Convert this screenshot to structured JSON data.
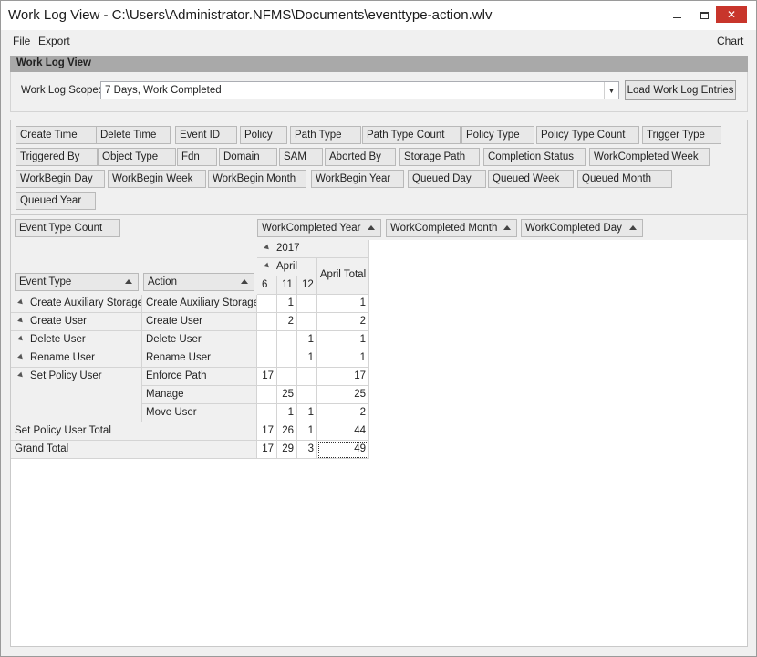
{
  "window": {
    "title": "Work Log View - C:\\Users\\Administrator.NFMS\\Documents\\eventtype-action.wlv",
    "controls": {
      "close": "✕"
    }
  },
  "menu": {
    "file": "File",
    "export": "Export",
    "chart": "Chart"
  },
  "panel": {
    "title": "Work Log View",
    "scope_label": "Work Log Scope:",
    "scope_value": "7 Days, Work Completed",
    "load_button": "Load Work Log Entries"
  },
  "filter_fields": [
    "Create Time",
    "Delete Time",
    "Event ID",
    "Policy",
    "Path Type",
    "Path Type Count",
    "Policy Type",
    "Policy Type Count",
    "Trigger Type",
    "Triggered By",
    "Object Type",
    "Fdn",
    "Domain",
    "SAM",
    "Aborted By",
    "Storage Path",
    "Completion Status",
    "WorkCompleted Week",
    "WorkBegin Day",
    "WorkBegin Week",
    "WorkBegin Month",
    "WorkBegin Year",
    "Queued Day",
    "Queued Week",
    "Queued Month",
    "Queued Year"
  ],
  "data_field": "Event Type Count",
  "column_fields": [
    "WorkCompleted Year",
    "WorkCompleted Month",
    "WorkCompleted Day"
  ],
  "row_fields": [
    "Event Type",
    "Action"
  ],
  "columns": {
    "year": "2017",
    "month": "April",
    "days": [
      "6",
      "11",
      "12"
    ],
    "month_total": "April Total"
  },
  "rows": [
    {
      "event": "Create Auxiliary Storage",
      "action": "Create Auxiliary Storage",
      "d6": "",
      "d11": "1",
      "d12": "",
      "total": "1"
    },
    {
      "event": "Create User",
      "action": "Create User",
      "d6": "",
      "d11": "2",
      "d12": "",
      "total": "2"
    },
    {
      "event": "Delete User",
      "action": "Delete User",
      "d6": "",
      "d11": "",
      "d12": "1",
      "total": "1"
    },
    {
      "event": "Rename User",
      "action": "Rename User",
      "d6": "",
      "d11": "",
      "d12": "1",
      "total": "1"
    },
    {
      "event": "Set Policy User",
      "action": "Enforce Path",
      "d6": "17",
      "d11": "",
      "d12": "",
      "total": "17"
    },
    {
      "event": "",
      "action": "Manage",
      "d6": "",
      "d11": "25",
      "d12": "",
      "total": "25"
    },
    {
      "event": "",
      "action": "Move User",
      "d6": "",
      "d11": "1",
      "d12": "1",
      "total": "2"
    }
  ],
  "subtotal": {
    "label": "Set Policy User Total",
    "d6": "17",
    "d11": "26",
    "d12": "1",
    "total": "44"
  },
  "grand_total": {
    "label": "Grand Total",
    "d6": "17",
    "d11": "29",
    "d12": "3",
    "total": "49"
  }
}
